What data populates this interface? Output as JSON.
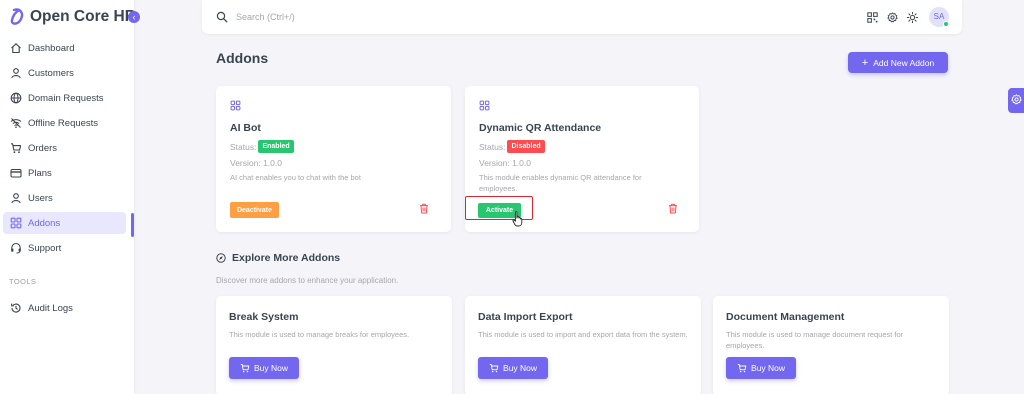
{
  "brand": {
    "name": "Open Core HR"
  },
  "sidebar": {
    "items": [
      {
        "label": "Dashboard",
        "icon": "home-icon"
      },
      {
        "label": "Customers",
        "icon": "user-icon"
      },
      {
        "label": "Domain Requests",
        "icon": "globe-icon"
      },
      {
        "label": "Offline Requests",
        "icon": "wifi-off-icon"
      },
      {
        "label": "Orders",
        "icon": "cart-icon"
      },
      {
        "label": "Plans",
        "icon": "credit-card-icon"
      },
      {
        "label": "Users",
        "icon": "user-icon"
      },
      {
        "label": "Addons",
        "icon": "grid-icon",
        "active": true
      },
      {
        "label": "Support",
        "icon": "headset-icon"
      }
    ],
    "section_label": "TOOLS",
    "tools_items": [
      {
        "label": "Audit Logs",
        "icon": "history-icon"
      }
    ]
  },
  "topbar": {
    "search_placeholder": "Search (Ctrl+/)",
    "avatar_initials": "SA"
  },
  "page": {
    "title": "Addons",
    "add_button_label": "Add New Addon"
  },
  "installed_addons": [
    {
      "name": "AI Bot",
      "status_label": "Status:",
      "status": "Enabled",
      "version": "Version: 1.0.0",
      "description": "AI chat enables you to chat with the bot",
      "action_label": "Deactivate"
    },
    {
      "name": "Dynamic QR Attendance",
      "status_label": "Status:",
      "status": "Disabled",
      "version": "Version: 1.0.0",
      "description": "This module enables dynamic QR attendance for employees.",
      "action_label": "Activate"
    }
  ],
  "explore": {
    "title": "Explore More Addons",
    "subtitle": "Discover more addons to enhance your application.",
    "cards": [
      {
        "name": "Break System",
        "description": "This module is used to manage breaks for employees.",
        "button_label": "Buy Now"
      },
      {
        "name": "Data Import Export",
        "description": "This module is used to import and export data from the system.",
        "button_label": "Buy Now"
      },
      {
        "name": "Document Management",
        "description": "This module is used to manage document request for employees.",
        "button_label": "Buy Now"
      }
    ]
  },
  "colors": {
    "primary": "#7367f0",
    "success": "#28c76f",
    "danger": "#ff4c51",
    "warning": "#ff9f43",
    "background": "#f5f5f9"
  }
}
